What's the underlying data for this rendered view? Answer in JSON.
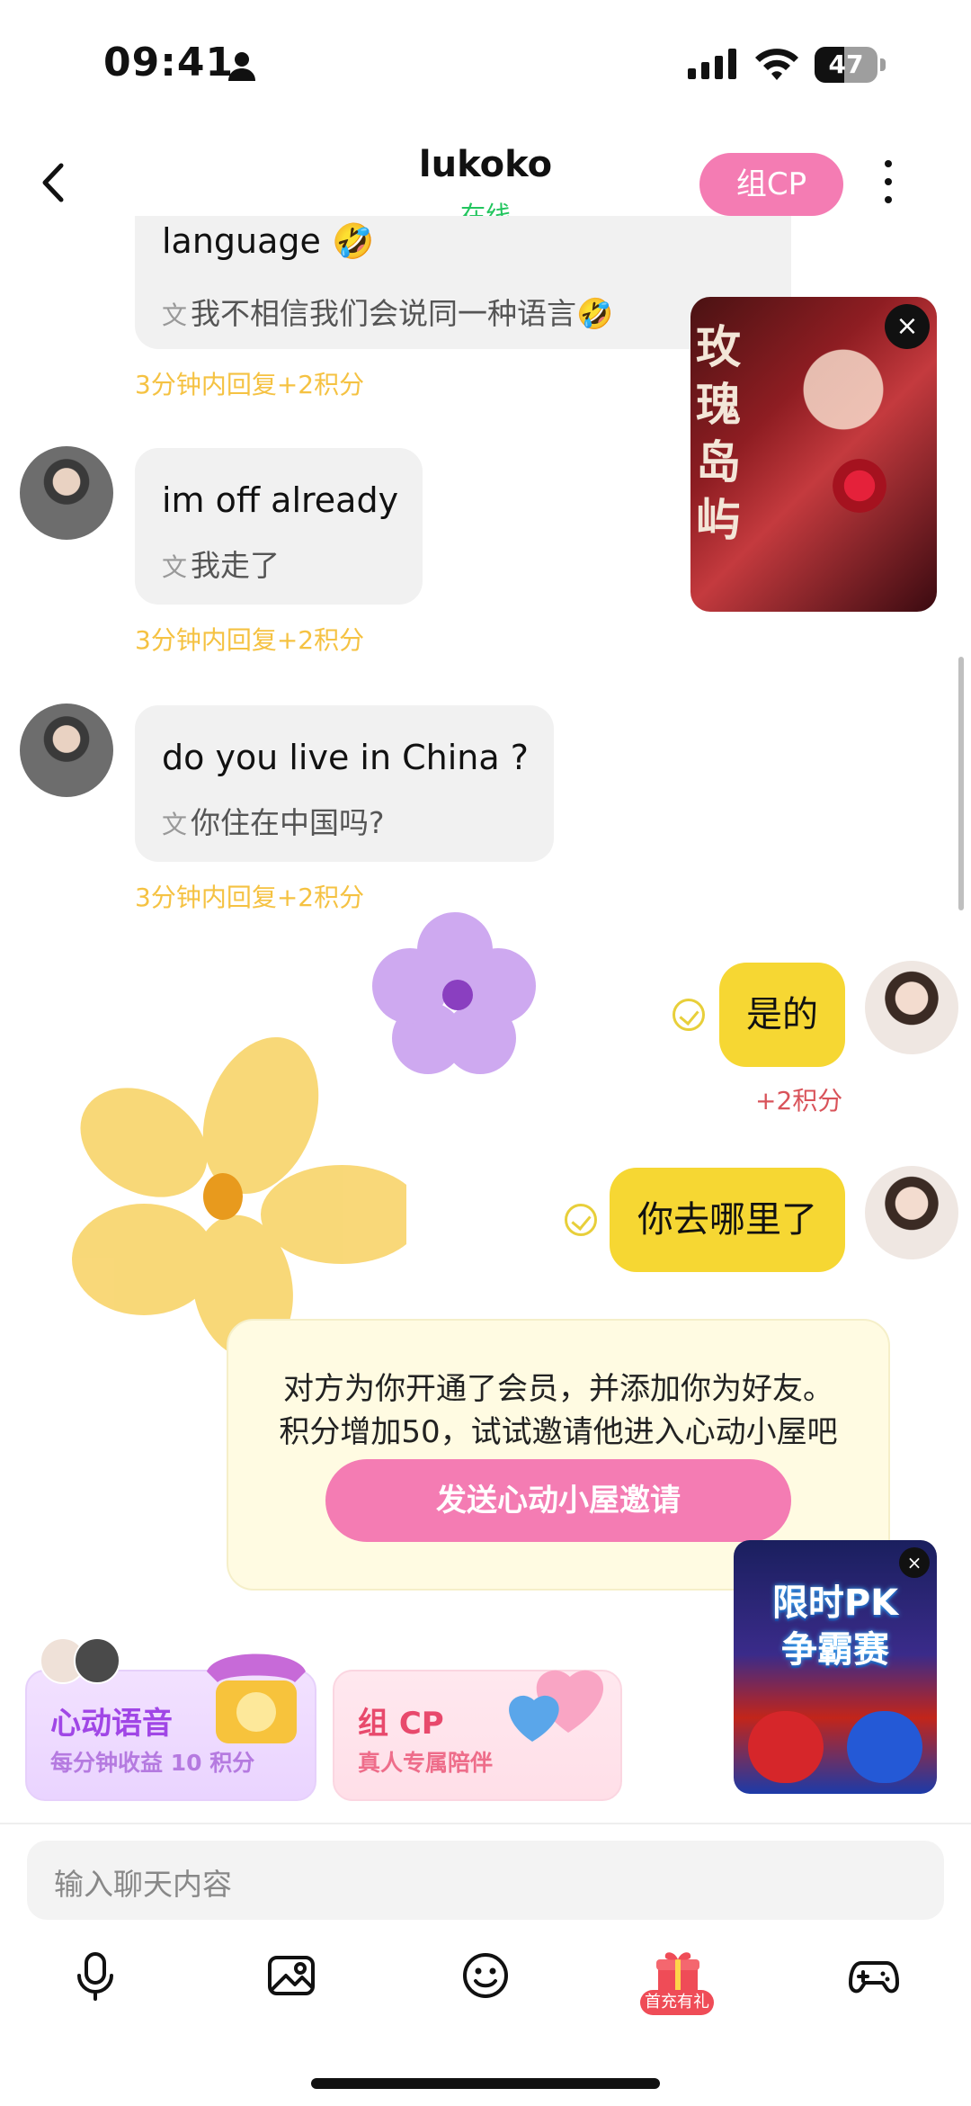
{
  "status_bar": {
    "time": "09:41",
    "battery": "47",
    "battery_level": 0.47
  },
  "header": {
    "title": "lukoko",
    "status": "在线",
    "cp_button": "组CP"
  },
  "messages": [
    {
      "side": "left",
      "text": "language 🤣",
      "translation": "我不相信我们会说同一种语言🤣",
      "reward": "3分钟内回复+2积分"
    },
    {
      "side": "left",
      "text": "im off already",
      "translation": "我走了",
      "reward": "3分钟内回复+2积分"
    },
    {
      "side": "left",
      "text": "do you live in China ?",
      "translation": "你住在中国吗?",
      "reward": "3分钟内回复+2积分"
    },
    {
      "side": "right",
      "text": "是的",
      "points": "+2积分"
    },
    {
      "side": "right",
      "text": "你去哪里了"
    }
  ],
  "ad_card": {
    "title_chars": "玫瑰岛屿",
    "close": "×"
  },
  "member_notice": {
    "line1": "对方为你开通了会员，并添加你为好友。",
    "line2": "积分增加50，试试邀请他进入心动小屋吧",
    "button": "发送心动小屋邀请"
  },
  "feature_cards": [
    {
      "title": "心动语音",
      "subtitle": "每分钟收益 10 积分",
      "title_color": "#a046e6",
      "sub_color": "#b57ae0"
    },
    {
      "title": "组 CP",
      "subtitle": "真人专属陪伴",
      "title_color": "#e8496c",
      "sub_color": "#ee6d8a"
    }
  ],
  "pk_banner": {
    "text_line1": "限时PK",
    "text_line2": "争霸赛",
    "close": "×"
  },
  "composer": {
    "placeholder": "输入聊天内容"
  },
  "toolbar": {
    "items": [
      "microphone-icon",
      "image-icon",
      "emoji-icon",
      "gift-icon",
      "gamepad-icon"
    ],
    "gift_badge": "首充有礼"
  }
}
